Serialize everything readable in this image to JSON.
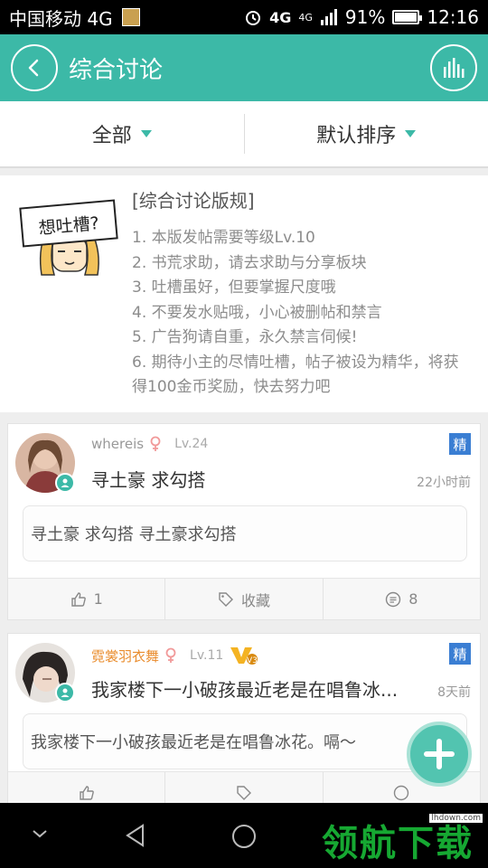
{
  "status": {
    "carrier": "中国移动 4G",
    "net1": "4G",
    "net2": "4G",
    "battery_pct": "91%",
    "battery_level": 0.91,
    "time": "12:16"
  },
  "header": {
    "title": "综合讨论",
    "back_icon": "chevron-left-icon",
    "chart_icon": "bar-chart-icon",
    "accent_color": "#3cb9a7"
  },
  "filters": {
    "category": "全部",
    "sort": "默认排序"
  },
  "rules": {
    "mascot_text": "想吐槽?",
    "title": "[综合讨论版规]",
    "lines": [
      "1. 本版发帖需要等级Lv.10",
      "2. 书荒求助，请去求助与分享板块",
      "3. 吐槽虽好，但要掌握尺度哦",
      "4. 不要发水贴哦，小心被删帖和禁言",
      "5. 广告狗请自重，永久禁言伺候!",
      "6. 期待小主的尽情吐槽，帖子被设为精华，将获得100金币奖励，快去努力吧"
    ]
  },
  "posts": [
    {
      "username": "whereis",
      "level": "Lv.24",
      "badge": "精",
      "title": "寻土豪 求勾搭",
      "time": "22小时前",
      "excerpt": "寻土豪 求勾搭 寻土豪求勾搭",
      "likes": "1",
      "collect_label": "收藏",
      "comments": "8"
    },
    {
      "username": "霓裳羽衣舞",
      "level": "Lv.11",
      "vip_badge": "V3",
      "badge": "精",
      "title": "我家楼下一小破孩最近老是在唱鲁冰...",
      "time": "8天前",
      "excerpt": "我家楼下一小破孩最近老是在唱鲁冰花。嗝～"
    }
  ],
  "watermark": {
    "text": "领航下载",
    "url": "lhdown.com"
  }
}
